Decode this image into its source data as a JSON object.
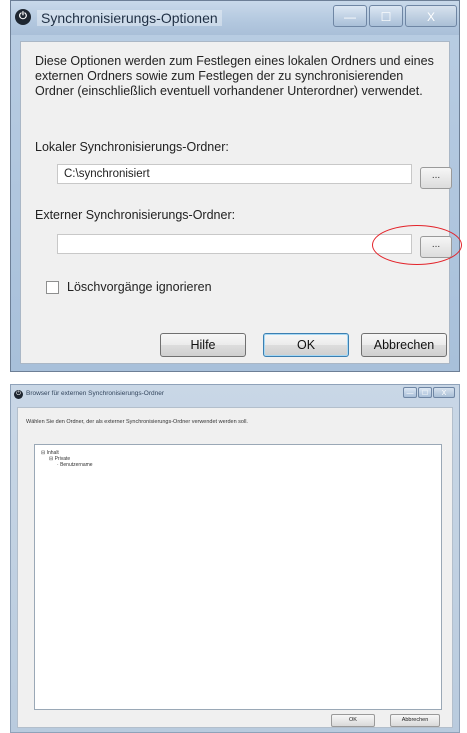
{
  "dialog1": {
    "title": "Synchronisierungs-Optionen",
    "icon": "app-icon",
    "caption": {
      "minimize": "—",
      "maximize": "☐",
      "close": "X"
    },
    "description": "Diese Optionen werden zum Festlegen eines lokalen Ordners und eines externen Ordners sowie zum Festlegen der zu synchronisierenden Ordner (einschließlich eventuell vorhandener Unterordner) verwendet.",
    "local_label": "Lokaler Synchronisierungs-Ordner:",
    "local_value": "C:\\synchronisiert",
    "external_label": "Externer Synchronisierungs-Ordner:",
    "external_value": "",
    "browse_label": "...",
    "ignore_delete_label": "Löschvorgänge ignorieren",
    "ignore_delete_checked": false,
    "buttons": {
      "help": "Hilfe",
      "ok": "OK",
      "cancel": "Abbrechen"
    },
    "highlight_color": "#e3232a"
  },
  "dialog2": {
    "title": "Browser für externen Synchronisierungs-Ordner",
    "icon": "app-icon",
    "description": "Wählen Sie den Ordner, der als externer Synchronisierungs-Ordner verwendet werden soll.",
    "tree": [
      {
        "label": "Inhalt",
        "prefix": "⊟"
      },
      {
        "label": "Private",
        "prefix": "⊟"
      },
      {
        "label": "Benutzername",
        "prefix": "·"
      }
    ],
    "buttons": {
      "ok": "OK",
      "cancel": "Abbrechen"
    }
  }
}
